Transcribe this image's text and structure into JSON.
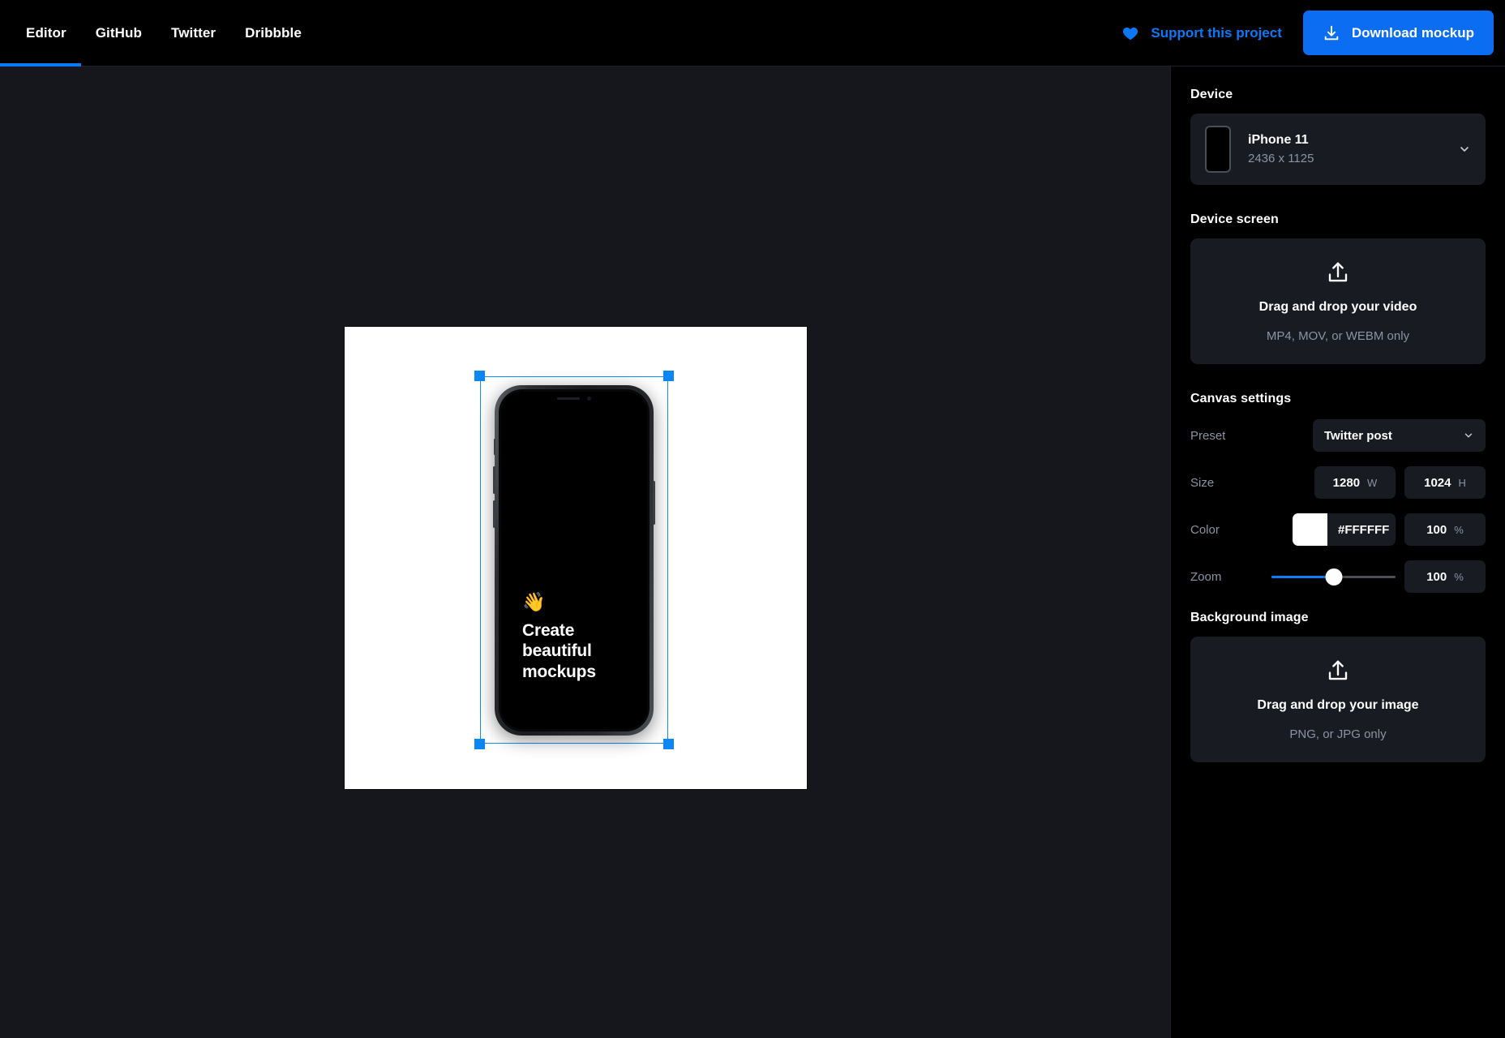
{
  "topbar": {
    "tabs": [
      {
        "label": "Editor",
        "active": true
      },
      {
        "label": "GitHub",
        "active": false
      },
      {
        "label": "Twitter",
        "active": false
      },
      {
        "label": "Dribbble",
        "active": false
      }
    ],
    "support_label": "Support this project",
    "download_label": "Download mockup",
    "heart_icon": "heart-icon",
    "download_icon": "download-icon",
    "accent_color": "#0b6df2",
    "support_color": "#0b79f7"
  },
  "canvas": {
    "artboard_color": "#FFFFFF",
    "workspace_color": "#15171c",
    "selection_color": "#0b86f5",
    "mockup": {
      "device": "iPhone 11",
      "screen_emoji": "👋",
      "screen_title": "Create\nbeautiful\nmockups",
      "screen_title_lines": [
        "Create",
        "beautiful",
        "mockups"
      ],
      "screen_background": "#000000"
    }
  },
  "sidebar": {
    "device_section": {
      "title": "Device",
      "selected_name": "iPhone 11",
      "selected_resolution": "2436 x 1125",
      "chevron_icon": "chevron-down-icon"
    },
    "device_screen_section": {
      "title": "Device screen",
      "upload_icon": "upload-icon",
      "drop_main": "Drag and drop your video",
      "drop_sub": "MP4, MOV, or WEBM only"
    },
    "canvas_settings": {
      "title": "Canvas settings",
      "preset": {
        "label": "Preset",
        "value": "Twitter post",
        "chevron_icon": "chevron-down-icon"
      },
      "size": {
        "label": "Size",
        "width_value": "1280",
        "width_unit": "W",
        "height_value": "1024",
        "height_unit": "H"
      },
      "color": {
        "label": "Color",
        "swatch": "#FFFFFF",
        "hex": "#FFFFFF",
        "opacity_value": "100",
        "opacity_unit": "%"
      },
      "zoom": {
        "label": "Zoom",
        "value": "100",
        "unit": "%",
        "slider_percent": 50
      }
    },
    "background_image_section": {
      "title": "Background image",
      "upload_icon": "upload-icon",
      "drop_main": "Drag and drop your image",
      "drop_sub": "PNG, or JPG only"
    }
  }
}
